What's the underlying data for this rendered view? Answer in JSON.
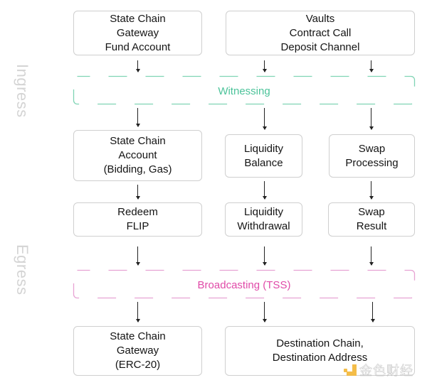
{
  "colors": {
    "witnessing": "#7fd4b4",
    "witnessing_text": "#4cc39a",
    "broadcasting": "#e7a2d3",
    "broadcasting_text": "#e04aa8",
    "box_border": "#cfcfcf",
    "side_label": "#d4d4d4"
  },
  "side_labels": {
    "ingress": "Ingress",
    "egress": "Egress"
  },
  "bands": {
    "witnessing": "Witnessing",
    "broadcasting": "Broadcasting (TSS)"
  },
  "nodes": {
    "gateway_fund": {
      "lines": [
        "State Chain",
        "Gateway",
        "Fund Account"
      ]
    },
    "vaults": {
      "lines": [
        "Vaults",
        "Contract Call",
        "Deposit Channel"
      ]
    },
    "sc_account": {
      "lines": [
        "State Chain",
        "Account",
        "(Bidding, Gas)"
      ]
    },
    "liquidity_balance": {
      "lines": [
        "Liquidity",
        "Balance"
      ]
    },
    "swap_processing": {
      "lines": [
        "Swap",
        "Processing"
      ]
    },
    "redeem_flip": {
      "lines": [
        "Redeem",
        "FLIP"
      ]
    },
    "liquidity_withdrawal": {
      "lines": [
        "Liquidity",
        "Withdrawal"
      ]
    },
    "swap_result": {
      "lines": [
        "Swap",
        "Result"
      ]
    },
    "sc_gateway_erc20": {
      "lines": [
        "State Chain",
        "Gateway",
        "(ERC-20)"
      ]
    },
    "destination": {
      "lines": [
        "Destination Chain,",
        "Destination Address"
      ]
    }
  },
  "watermark": {
    "text": "金色财经",
    "icon": "jinse-logo-icon"
  }
}
